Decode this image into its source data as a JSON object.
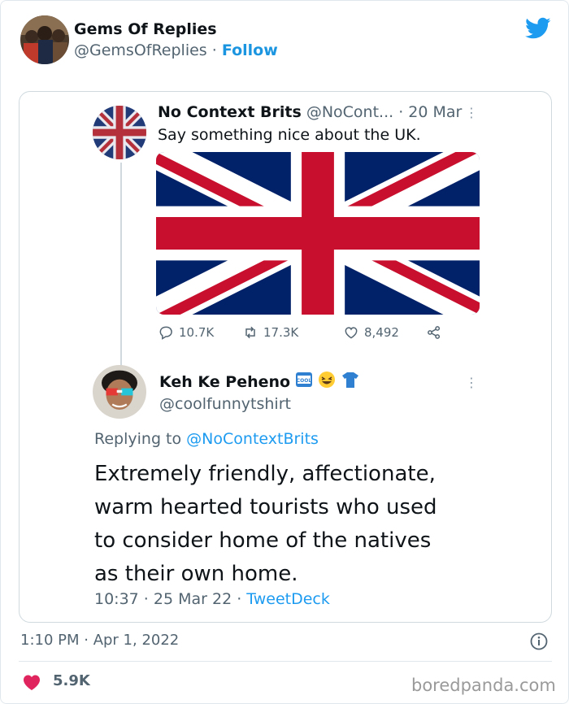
{
  "tweet": {
    "author_name": "Gems Of Replies",
    "author_handle": "@GemsOfReplies",
    "separator": "·",
    "follow_label": "Follow",
    "timestamp": "1:10 PM · Apr 1, 2022",
    "likes": "5.9K"
  },
  "quoted": {
    "name": "No Context Brits",
    "handle": "@NoCont...",
    "date": "· 20 Mar",
    "text": "Say something nice about the UK.",
    "replies": "10.7K",
    "retweets": "17.3K",
    "likes": "8,492"
  },
  "reply": {
    "name": "Keh Ke Peheno",
    "badge_text": "COOL",
    "handle": "@coolfunnytshirt",
    "replying_prefix": "Replying to",
    "replying_to": "@NoContextBrits",
    "text_lines": [
      "Extremely friendly, affectionate,",
      "warm hearted tourists who used",
      "to consider home of the natives",
      "as their own home."
    ],
    "time": "10:37 · 25 Mar 22 ·",
    "source": "TweetDeck"
  },
  "watermark": "boredpanda.com",
  "colors": {
    "link_blue": "#1b95e0",
    "twitter_blue": "#1d9bf0",
    "heart_pink": "#e0245e",
    "flag_blue": "#012169",
    "flag_red": "#c8102e"
  },
  "icons": [
    "twitter-bird-icon",
    "reply-icon",
    "retweet-icon",
    "heart-icon",
    "share-icon",
    "info-icon",
    "more-icon"
  ]
}
